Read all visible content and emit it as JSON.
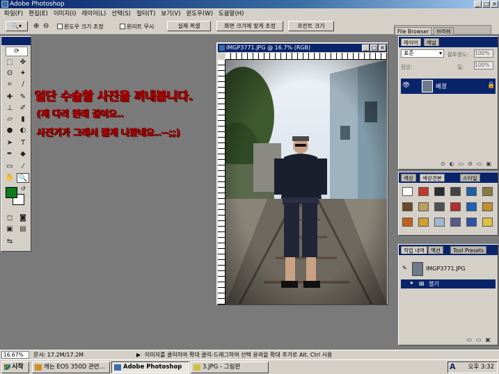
{
  "window": {
    "title": "Adobe Photoshop"
  },
  "menu": [
    "파일(F)",
    "편집(E)",
    "이미지(I)",
    "레이어(L)",
    "선택(S)",
    "필터(T)",
    "보기(V)",
    "윈도우(W)",
    "도움말(H)"
  ],
  "options": {
    "resize_window": "윈도우 크기 조정",
    "all_windows": "윈리트 무시",
    "actual_pixels": "실제 픽셀",
    "fit_on_screen": "화면 크기에 맞게 조정",
    "print_size": "프린트 크기"
  },
  "palette_well": {
    "file_browser": "File Browser",
    "brushes": "브러쉬"
  },
  "document": {
    "title": "IMGP3771.JPG @ 16.7% (RGB)"
  },
  "overlay_text": {
    "line1": "일단 수술할 사진을 꺼내봅니다.",
    "line2": "(제 다리 원래 길어요..",
    "line3": "사진기가 그래서 짧게 나왔네요..--;;)"
  },
  "layers_panel": {
    "tabs": [
      "레이어",
      "채널"
    ],
    "blend_mode": "표준",
    "opacity_label": "불투명도:",
    "opacity_value": "100%",
    "lock_label": "잠금:",
    "fill_label": "칠:",
    "fill_value": "100%",
    "layer_name": "배경"
  },
  "swatches_panel": {
    "tabs": [
      "색상",
      "색상견본",
      "스타일"
    ],
    "colors": [
      "#ffffff",
      "#c0392b",
      "#2c2c2c",
      "#444444",
      "#1f5fa8",
      "#8a7a40",
      "#6b4a2a",
      "#b8a060",
      "#505050",
      "#b03030",
      "#2060b0",
      "#c09030",
      "#c06020",
      "#d0a030",
      "#a0b8d0",
      "#5a5a8a",
      "#3050a0",
      "#e0c040"
    ]
  },
  "history_panel": {
    "tabs": [
      "작업 내역",
      "액션",
      "Tool Presets"
    ],
    "snapshot": "IMGP3771.JPG",
    "step": "열기"
  },
  "status": {
    "zoom": "16.67%",
    "doc_size": "문서: 17.2M/17.2M",
    "hint": "이미지를 클릭하여 확대 클릭-드래그하여 선택 윤곽을 확대 추가로 Alt, Ctrl 사용"
  },
  "taskbar": {
    "start": "시작",
    "tasks": [
      "캐논 EOS 350D 관련...",
      "Adobe Photoshop",
      "3.JPG - 그림판"
    ],
    "clock": "오후 3:32",
    "ime": "A"
  },
  "colors": {
    "foreground": "#0f7a1f",
    "background": "#ffffff",
    "title_blue": "#0a246a",
    "overlay_red": "#c00000"
  }
}
